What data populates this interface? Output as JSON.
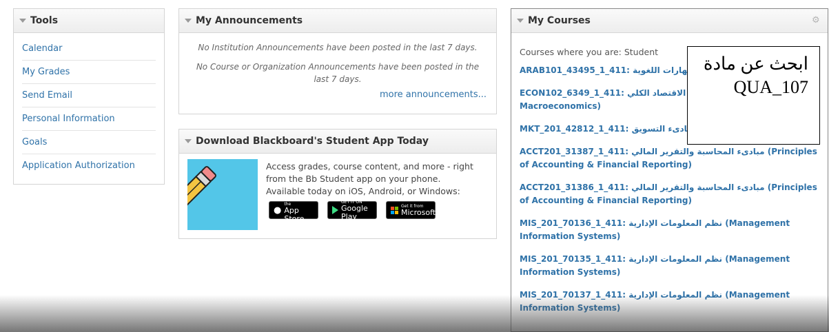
{
  "tools": {
    "title": "Tools",
    "items": [
      "Calendar",
      "My Grades",
      "Send Email",
      "Personal Information",
      "Goals",
      "Application Authorization"
    ]
  },
  "announcements": {
    "title": "My Announcements",
    "institution": "No Institution Announcements have been posted in the last 7 days.",
    "course": "No Course or Organization Announcements have been posted in the last 7 days.",
    "more": "more announcements..."
  },
  "app_promo": {
    "title": "Download Blackboard's Student App Today",
    "text": "Access grades, course content, and more - right from the Bb Student app on your phone.",
    "availability": "Available today on iOS, Android, or Windows:",
    "stores": [
      {
        "small": "Download on the",
        "big": "App Store",
        "icon": "apple-icon"
      },
      {
        "small": "GET IT ON",
        "big": "Google Play",
        "icon": "google-play-icon"
      },
      {
        "small": "Get it from",
        "big": "Microsoft",
        "icon": "microsoft-icon"
      }
    ]
  },
  "courses": {
    "title": "My Courses",
    "role_label": "Courses where you are: Student",
    "items": [
      "ARAB101_43495_1_411: المهارات اللغوية (Language Skills)",
      "ECON102_6349_1_411: مبادىء الاقتصاد الكلي (Principles of Macroeconomics)",
      "MKT_201_42812_1_411: مبادىء التسويق (Principles of Marketing)",
      "ACCT201_31387_1_411: مبادىء المحاسبة والتقرير المالي (Principles of Accounting & Financial Reporting)",
      "ACCT201_31386_1_411: مبادىء المحاسبة والتقرير المالي (Principles of Accounting & Financial Reporting)",
      "MIS_201_70136_1_411: نظم المعلومات الإدارية (Management Information Systems)",
      "MIS_201_70135_1_411: نظم المعلومات الإدارية (Management Information Systems)",
      "MIS_201_70137_1_411: نظم المعلومات الإدارية (Management Information Systems)"
    ]
  },
  "overlay": {
    "line1": "ابحث عن مادة",
    "line2": "QUA_107"
  }
}
